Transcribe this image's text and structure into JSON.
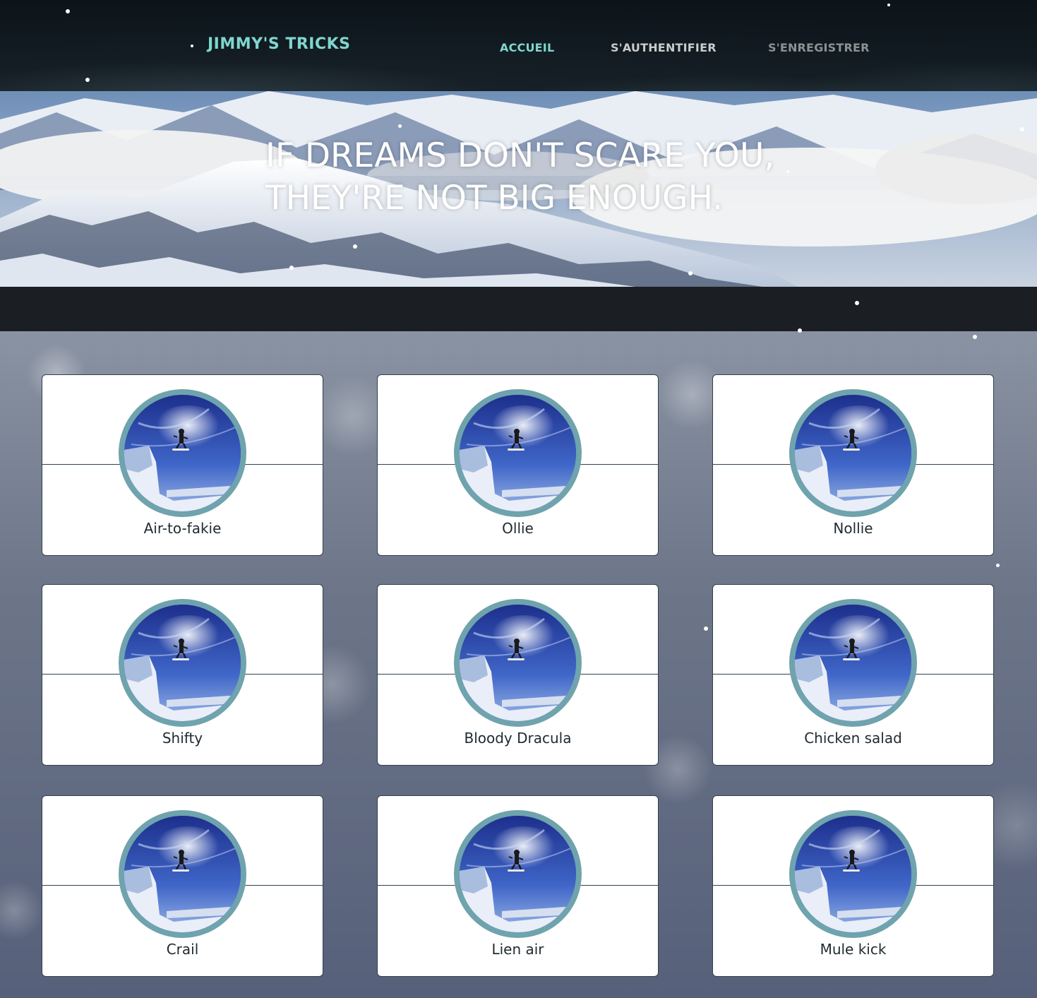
{
  "header": {
    "logo": "JIMMY'S TRICKS",
    "nav": [
      {
        "label": "ACCUEIL"
      },
      {
        "label": "S'AUTHENTIFIER"
      },
      {
        "label": "S'ENREGISTRER"
      }
    ]
  },
  "hero": {
    "quote_line1": "IF DREAMS DON'T SCARE YOU,",
    "quote_line2": "THEY'RE NOT BIG ENOUGH."
  },
  "tricks": [
    {
      "name": "Air-to-fakie"
    },
    {
      "name": "Ollie"
    },
    {
      "name": "Nollie"
    },
    {
      "name": "Shifty"
    },
    {
      "name": "Bloody Dracula"
    },
    {
      "name": "Chicken salad"
    },
    {
      "name": "Crail"
    },
    {
      "name": "Lien air"
    },
    {
      "name": "Mule kick"
    }
  ],
  "colors": {
    "accent": "#7fd6cf",
    "thumb_ring": "#6fa3ad",
    "header_bg": "#121c22",
    "band_bg": "#1b1f23"
  },
  "icons": {
    "trick_thumbnail": "snowboarder-jump-image"
  }
}
